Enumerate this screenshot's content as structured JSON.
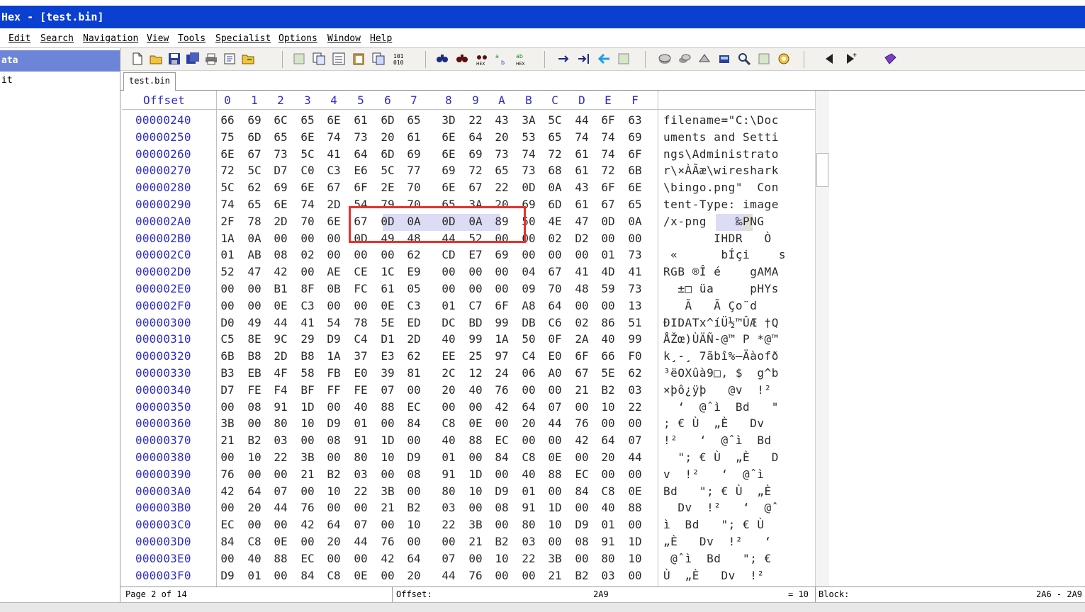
{
  "window": {
    "title": "Hex - [test.bin]"
  },
  "menu": [
    "Edit",
    "Search",
    "Navigation",
    "View",
    "Tools",
    "Specialist",
    "Options",
    "Window",
    "Help"
  ],
  "left_panel": {
    "selected": "ata",
    "item": "it"
  },
  "toolbar": {
    "icons": [
      "new-file-icon",
      "open-file-icon",
      "save-icon",
      "save-all-icon",
      "print-icon",
      "properties-icon",
      "open-folder-icon",
      "cut-icon",
      "copy-icon",
      "copy-hex-icon",
      "paste-icon",
      "paste-special-icon",
      "binary-icon",
      "find-icon",
      "find-next-icon",
      "find-hex-icon",
      "replace-icon",
      "replace-hex-icon",
      "goto-offset-icon",
      "goto-sector-icon",
      "back-icon",
      "forward-icon",
      "disk-icon",
      "ram-icon",
      "drive-icon",
      "calculator-icon",
      "search-icon",
      "hash-icon",
      "gear-icon",
      "left-arrow-icon",
      "right-arrow-icon",
      "book-icon"
    ]
  },
  "tab": {
    "label": "test.bin"
  },
  "hex": {
    "header": {
      "offset_label": "Offset",
      "cols": [
        "0",
        "1",
        "2",
        "3",
        "4",
        "5",
        "6",
        "7",
        "8",
        "9",
        "A",
        "B",
        "C",
        "D",
        "E",
        "F"
      ]
    },
    "rows": [
      {
        "offset": "00000240",
        "bytes": [
          "66",
          "69",
          "6C",
          "65",
          "6E",
          "61",
          "6D",
          "65",
          "3D",
          "22",
          "43",
          "3A",
          "5C",
          "44",
          "6F",
          "63"
        ],
        "ascii": "filename=\"C:\\Doc"
      },
      {
        "offset": "00000250",
        "bytes": [
          "75",
          "6D",
          "65",
          "6E",
          "74",
          "73",
          "20",
          "61",
          "6E",
          "64",
          "20",
          "53",
          "65",
          "74",
          "74",
          "69"
        ],
        "ascii": "uments and Setti"
      },
      {
        "offset": "00000260",
        "bytes": [
          "6E",
          "67",
          "73",
          "5C",
          "41",
          "64",
          "6D",
          "69",
          "6E",
          "69",
          "73",
          "74",
          "72",
          "61",
          "74",
          "6F"
        ],
        "ascii": "ngs\\Administrato"
      },
      {
        "offset": "00000270",
        "bytes": [
          "72",
          "5C",
          "D7",
          "C0",
          "C3",
          "E6",
          "5C",
          "77",
          "69",
          "72",
          "65",
          "73",
          "68",
          "61",
          "72",
          "6B"
        ],
        "ascii": "r\\×ÀÃæ\\wireshark"
      },
      {
        "offset": "00000280",
        "bytes": [
          "5C",
          "62",
          "69",
          "6E",
          "67",
          "6F",
          "2E",
          "70",
          "6E",
          "67",
          "22",
          "0D",
          "0A",
          "43",
          "6F",
          "6E"
        ],
        "ascii": "\\bingo.png\"  Con"
      },
      {
        "offset": "00000290",
        "bytes": [
          "74",
          "65",
          "6E",
          "74",
          "2D",
          "54",
          "79",
          "70",
          "65",
          "3A",
          "20",
          "69",
          "6D",
          "61",
          "67",
          "65"
        ],
        "ascii": "tent-Type: image"
      },
      {
        "offset": "000002A0",
        "bytes": [
          "2F",
          "78",
          "2D",
          "70",
          "6E",
          "67",
          "0D",
          "0A",
          "0D",
          "0A",
          "89",
          "50",
          "4E",
          "47",
          "0D",
          "0A"
        ],
        "ascii": "/x-png    ‰PNG  "
      },
      {
        "offset": "000002B0",
        "bytes": [
          "1A",
          "0A",
          "00",
          "00",
          "00",
          "0D",
          "49",
          "48",
          "44",
          "52",
          "00",
          "00",
          "02",
          "D2",
          "00",
          "00"
        ],
        "ascii": "       IHDR   Ò  "
      },
      {
        "offset": "000002C0",
        "bytes": [
          "01",
          "AB",
          "08",
          "02",
          "00",
          "00",
          "00",
          "62",
          "CD",
          "E7",
          "69",
          "00",
          "00",
          "00",
          "01",
          "73"
        ],
        "ascii": " «      bÍçi    s"
      },
      {
        "offset": "000002D0",
        "bytes": [
          "52",
          "47",
          "42",
          "00",
          "AE",
          "CE",
          "1C",
          "E9",
          "00",
          "00",
          "00",
          "04",
          "67",
          "41",
          "4D",
          "41"
        ],
        "ascii": "RGB ®Î é    gAMA"
      },
      {
        "offset": "000002E0",
        "bytes": [
          "00",
          "00",
          "B1",
          "8F",
          "0B",
          "FC",
          "61",
          "05",
          "00",
          "00",
          "00",
          "09",
          "70",
          "48",
          "59",
          "73"
        ],
        "ascii": "  ±□ üa     pHYs"
      },
      {
        "offset": "000002F0",
        "bytes": [
          "00",
          "00",
          "0E",
          "C3",
          "00",
          "00",
          "0E",
          "C3",
          "01",
          "C7",
          "6F",
          "A8",
          "64",
          "00",
          "00",
          "13"
        ],
        "ascii": "   Ã   Ã Ço¨d   "
      },
      {
        "offset": "00000300",
        "bytes": [
          "D0",
          "49",
          "44",
          "41",
          "54",
          "78",
          "5E",
          "ED",
          "DC",
          "BD",
          "99",
          "DB",
          "C6",
          "02",
          "86",
          "51"
        ],
        "ascii": "ÐIDATx^íÜ½™ÛÆ †Q"
      },
      {
        "offset": "00000310",
        "bytes": [
          "C5",
          "8E",
          "9C",
          "29",
          "D9",
          "C4",
          "D1",
          "2D",
          "40",
          "99",
          "1A",
          "50",
          "0F",
          "2A",
          "40",
          "99"
        ],
        "ascii": "ÅŽœ)ÙÄÑ-@™ P *@™"
      },
      {
        "offset": "00000320",
        "bytes": [
          "6B",
          "B8",
          "2D",
          "B8",
          "1A",
          "37",
          "E3",
          "62",
          "EE",
          "25",
          "97",
          "C4",
          "E0",
          "6F",
          "66",
          "F0"
        ],
        "ascii": "k¸-¸ 7ãbî%—Äàofð"
      },
      {
        "offset": "00000330",
        "bytes": [
          "B3",
          "EB",
          "4F",
          "58",
          "FB",
          "E0",
          "39",
          "81",
          "2C",
          "12",
          "24",
          "06",
          "A0",
          "67",
          "5E",
          "62"
        ],
        "ascii": "³ëOXûà9□, $  g^b"
      },
      {
        "offset": "00000340",
        "bytes": [
          "D7",
          "FE",
          "F4",
          "BF",
          "FF",
          "FE",
          "07",
          "00",
          "20",
          "40",
          "76",
          "00",
          "00",
          "21",
          "B2",
          "03"
        ],
        "ascii": "×þô¿ÿþ   @v  !² "
      },
      {
        "offset": "00000350",
        "bytes": [
          "00",
          "08",
          "91",
          "1D",
          "00",
          "40",
          "88",
          "EC",
          "00",
          "00",
          "42",
          "64",
          "07",
          "00",
          "10",
          "22"
        ],
        "ascii": "  ‘  @ˆì  Bd   \""
      },
      {
        "offset": "00000360",
        "bytes": [
          "3B",
          "00",
          "80",
          "10",
          "D9",
          "01",
          "00",
          "84",
          "C8",
          "0E",
          "00",
          "20",
          "44",
          "76",
          "00",
          "00"
        ],
        "ascii": "; € Ù  „È   Dv  "
      },
      {
        "offset": "00000370",
        "bytes": [
          "21",
          "B2",
          "03",
          "00",
          "08",
          "91",
          "1D",
          "00",
          "40",
          "88",
          "EC",
          "00",
          "00",
          "42",
          "64",
          "07"
        ],
        "ascii": "!²   ‘  @ˆì  Bd "
      },
      {
        "offset": "00000380",
        "bytes": [
          "00",
          "10",
          "22",
          "3B",
          "00",
          "80",
          "10",
          "D9",
          "01",
          "00",
          "84",
          "C8",
          "0E",
          "00",
          "20",
          "44"
        ],
        "ascii": "  \"; € Ù  „È   D"
      },
      {
        "offset": "00000390",
        "bytes": [
          "76",
          "00",
          "00",
          "21",
          "B2",
          "03",
          "00",
          "08",
          "91",
          "1D",
          "00",
          "40",
          "88",
          "EC",
          "00",
          "00"
        ],
        "ascii": "v  !²   ‘  @ˆì  "
      },
      {
        "offset": "000003A0",
        "bytes": [
          "42",
          "64",
          "07",
          "00",
          "10",
          "22",
          "3B",
          "00",
          "80",
          "10",
          "D9",
          "01",
          "00",
          "84",
          "C8",
          "0E"
        ],
        "ascii": "Bd   \"; € Ù  „È "
      },
      {
        "offset": "000003B0",
        "bytes": [
          "00",
          "20",
          "44",
          "76",
          "00",
          "00",
          "21",
          "B2",
          "03",
          "00",
          "08",
          "91",
          "1D",
          "00",
          "40",
          "88"
        ],
        "ascii": "  Dv  !²   ‘  @ˆ"
      },
      {
        "offset": "000003C0",
        "bytes": [
          "EC",
          "00",
          "00",
          "42",
          "64",
          "07",
          "00",
          "10",
          "22",
          "3B",
          "00",
          "80",
          "10",
          "D9",
          "01",
          "00"
        ],
        "ascii": "ì  Bd   \"; € Ù  "
      },
      {
        "offset": "000003D0",
        "bytes": [
          "84",
          "C8",
          "0E",
          "00",
          "20",
          "44",
          "76",
          "00",
          "00",
          "21",
          "B2",
          "03",
          "00",
          "08",
          "91",
          "1D"
        ],
        "ascii": "„È   Dv  !²   ‘ "
      },
      {
        "offset": "000003E0",
        "bytes": [
          "00",
          "40",
          "88",
          "EC",
          "00",
          "00",
          "42",
          "64",
          "07",
          "00",
          "10",
          "22",
          "3B",
          "00",
          "80",
          "10"
        ],
        "ascii": " @ˆì  Bd   \"; € "
      },
      {
        "offset": "000003F0",
        "bytes": [
          "D9",
          "01",
          "00",
          "84",
          "C8",
          "0E",
          "00",
          "20",
          "44",
          "76",
          "00",
          "00",
          "21",
          "B2",
          "03",
          "00"
        ],
        "ascii": "Ù  „È   Dv  !²  "
      }
    ]
  },
  "status": {
    "page": "Page 2 of 14",
    "offset_label": "Offset:",
    "offset_value": "2A9",
    "value": "= 10",
    "block_label": "Block:",
    "block_value": "2A6 - 2A9"
  },
  "colors": {
    "title_bg": "#0a3fcf",
    "selection": "#6c85d8",
    "highlight_box": "#e8322c"
  }
}
